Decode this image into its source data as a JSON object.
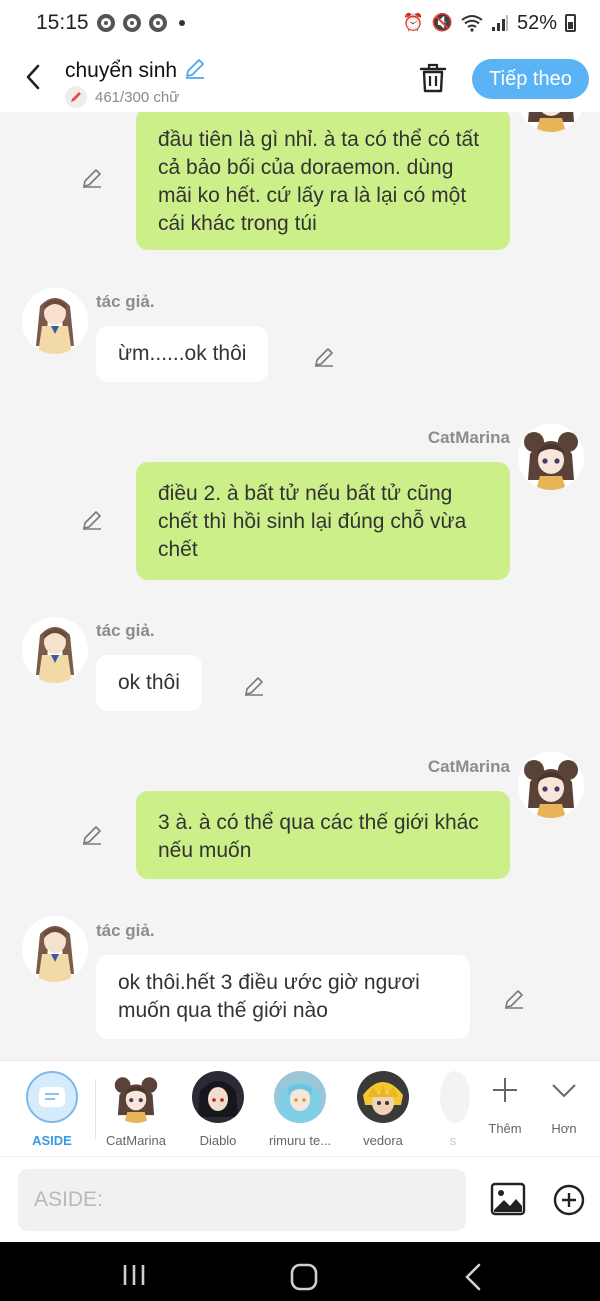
{
  "status_bar": {
    "time": "15:15",
    "battery": "52%",
    "icons": [
      "chrome-icon",
      "chrome-icon",
      "chrome-icon",
      "notification-dot",
      "alarm-icon",
      "mute-icon",
      "wifi-icon",
      "signal-icon",
      "battery-icon"
    ]
  },
  "header": {
    "title": "chuyển sinh",
    "word_count": "461/300 chữ",
    "next_label": "Tiếp theo",
    "accent_color": "#59b3f4"
  },
  "messages": [
    {
      "sender": "CatMarina",
      "side": "right",
      "show_name": false,
      "text": "đầu tiên là gì nhỉ. à ta có thể có tất cả bảo bối của doraemon. dùng mãi ko hết. cứ lấy ra là lại có một cái khác trong túi"
    },
    {
      "sender": "tác giả.",
      "side": "left",
      "show_name": true,
      "text": "ừm......ok thôi"
    },
    {
      "sender": "CatMarina",
      "side": "right",
      "show_name": true,
      "text": "điều 2. à bất tử nếu bất tử cũng chết thì hồi sinh lại đúng chỗ vừa chết"
    },
    {
      "sender": "tác giả.",
      "side": "left",
      "show_name": true,
      "text": "ok thôi"
    },
    {
      "sender": "CatMarina",
      "side": "right",
      "show_name": true,
      "text": "3 à. à có thể qua các thế giới khác nếu muốn"
    },
    {
      "sender": "tác giả.",
      "side": "left",
      "show_name": true,
      "text": "ok thôi.hết 3 điều ước giờ ngươi muốn qua thế giới nào"
    }
  ],
  "characters": [
    {
      "name": "ASIDE",
      "active": true
    },
    {
      "name": "CatMarina",
      "active": false
    },
    {
      "name": "Diablo",
      "active": false
    },
    {
      "name": "rimuru te...",
      "active": false
    },
    {
      "name": "vedora",
      "active": false
    },
    {
      "name": "s",
      "active": false
    }
  ],
  "char_actions": {
    "add_label": "Thêm",
    "more_label": "Hơn"
  },
  "input": {
    "placeholder": "ASIDE:"
  },
  "colors": {
    "right_bubble": "#cdef8a",
    "left_bubble": "#ffffff",
    "background": "#f4f4f4"
  }
}
